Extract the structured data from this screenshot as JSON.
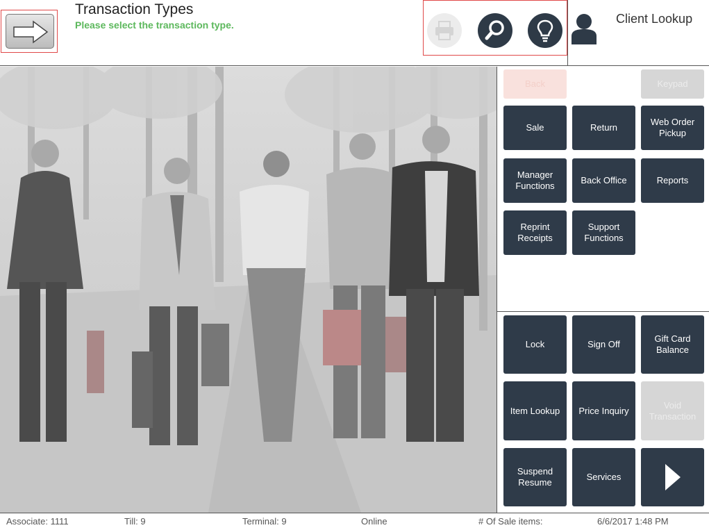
{
  "header": {
    "title": "Transaction Types",
    "subtitle": "Please select the transaction type.",
    "client_lookup": "Client Lookup"
  },
  "tools": {
    "print_icon": "printer-icon",
    "search_icon": "search-icon",
    "tip_icon": "lightbulb-icon"
  },
  "panel": {
    "top": {
      "back": "Back",
      "keypad": "Keypad"
    },
    "transactions": [
      "Sale",
      "Return",
      "Web Order\nPickup",
      "Manager\nFunctions",
      "Back Office",
      "Reports",
      "Reprint\nReceipts",
      "Support\nFunctions"
    ],
    "actions": [
      "Lock",
      "Sign Off",
      "Gift Card\nBalance",
      "Item Lookup",
      "Price Inquiry",
      "Void\nTransaction",
      "Suspend\nResume",
      "Services"
    ]
  },
  "status": {
    "associate": "Associate: 1111",
    "till": "Till: 9",
    "terminal": "Terminal: 9",
    "connection": "Online",
    "sale_items": "# Of Sale items:",
    "datetime": "6/6/2017 1:48 PM"
  },
  "colors": {
    "button": "#2f3b49",
    "accent_green": "#5cb85c",
    "highlight_red": "#e04848"
  }
}
